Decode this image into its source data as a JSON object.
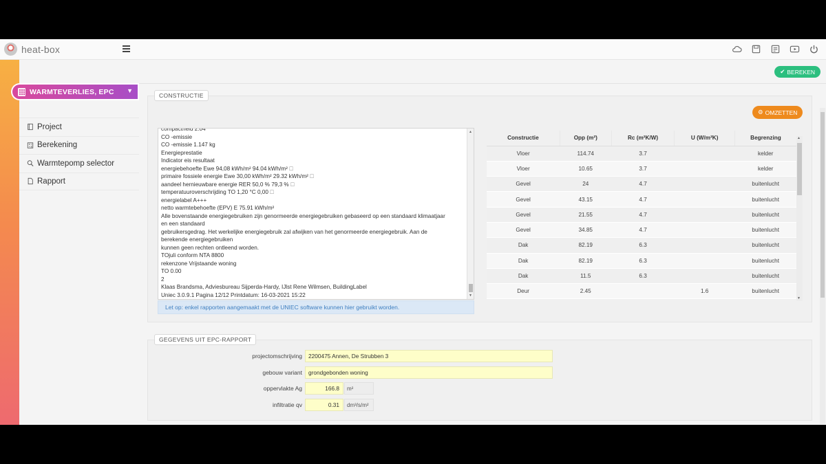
{
  "app": {
    "name": "heat-box",
    "top_icons": [
      "cloud-icon",
      "save-icon",
      "notes-icon",
      "video-icon",
      "power-icon"
    ]
  },
  "sidebar": {
    "module": "WARMTEVERLIES, EPC",
    "items": [
      {
        "label": "Project",
        "icon": "document-icon"
      },
      {
        "label": "Berekening",
        "icon": "calculator-icon"
      },
      {
        "label": "Warmtepomp selector",
        "icon": "search-icon"
      },
      {
        "label": "Rapport",
        "icon": "file-icon"
      }
    ]
  },
  "toolbar": {
    "calculate_label": "BEREKEN"
  },
  "constructie": {
    "legend": "CONSTRUCTIE",
    "convert_label": "OMZETTEN",
    "text_lines": [
      "compactheid 2.04",
      "CO -emissie",
      "CO -emissie 1.147 kg",
      "Energieprestatie",
      "Indicator eis resultaat",
      "energiebehoefte Ewe 94,08 kWh/m² 94.04 kWh/m² 🗆",
      "primaire fossiele energie Ewe 30,00 kWh/m² 29.32 kWh/m² 🗆",
      "aandeel hernieuwbare energie RER 50,0 % 79,3 % 🗆",
      "temperatuuroverschrijding TO 1,20 °C 0,00 🗆",
      "energielabel A+++",
      "netto warmtebehoefte (EPV) E 75.91 kWh/m²",
      "Alle bovenstaande energiegebruiken zijn genormeerde energiegebruiken gebaseerd op een standaard klimaatjaar",
      "en een standaard",
      "gebruikersgedrag. Het werkelijke energiegebruik zal afwijken van het genormeerde energiegebruik. Aan de",
      "berekende energiegebruiken",
      "kunnen geen rechten ontleend worden.",
      "TOjuli conform NTA 8800",
      "rekenzone Vrijstaande woning",
      "TO 0.00",
      "2",
      "Klaas Brandsma, Adviesbureau Sijperda-Hardy, IJlst Rene Wilmsen, BuildingLabel",
      "Uniec 3.0.9.1 Pagina 12/12 Printdatum: 16-03-2021 15:22"
    ],
    "notice": "Let op: enkel rapporten aangemaakt met de UNIEC software kunnen hier gebruikt worden.",
    "table": {
      "headers": [
        "Constructie",
        "Opp (m²)",
        "Rc (m²K/W)",
        "U (W/m²K)",
        "Begrenzing"
      ],
      "rows": [
        [
          "Vloer",
          "114.74",
          "3.7",
          "",
          "kelder"
        ],
        [
          "Vloer",
          "10.65",
          "3.7",
          "",
          "kelder"
        ],
        [
          "Gevel",
          "24",
          "4.7",
          "",
          "buitenlucht"
        ],
        [
          "Gevel",
          "43.15",
          "4.7",
          "",
          "buitenlucht"
        ],
        [
          "Gevel",
          "21.55",
          "4.7",
          "",
          "buitenlucht"
        ],
        [
          "Gevel",
          "34.85",
          "4.7",
          "",
          "buitenlucht"
        ],
        [
          "Dak",
          "82.19",
          "6.3",
          "",
          "buitenlucht"
        ],
        [
          "Dak",
          "82.19",
          "6.3",
          "",
          "buitenlucht"
        ],
        [
          "Dak",
          "11.5",
          "6.3",
          "",
          "buitenlucht"
        ],
        [
          "Deur",
          "2.45",
          "",
          "1.6",
          "buitenlucht"
        ]
      ]
    }
  },
  "epc": {
    "legend": "GEGEVENS UIT EPC-RAPPORT",
    "fields": {
      "projectomschrijving": {
        "label": "projectomschrijving",
        "value": "2200475 Annen, De Strubben 3"
      },
      "gebouw_variant": {
        "label": "gebouw variant",
        "value": "grondgebonden woning"
      },
      "oppervlakte": {
        "label": "oppervlakte Ag",
        "value": "166.8",
        "unit": "m²"
      },
      "infiltratie": {
        "label": "infiltratie qv",
        "value": "0.31",
        "unit": "dm³/s/m²"
      }
    }
  },
  "colors": {
    "accent_green": "#2cbf7f",
    "accent_orange": "#ee8a1d",
    "module_gradient_start": "#d9499c",
    "module_gradient_end": "#a74ec7"
  }
}
